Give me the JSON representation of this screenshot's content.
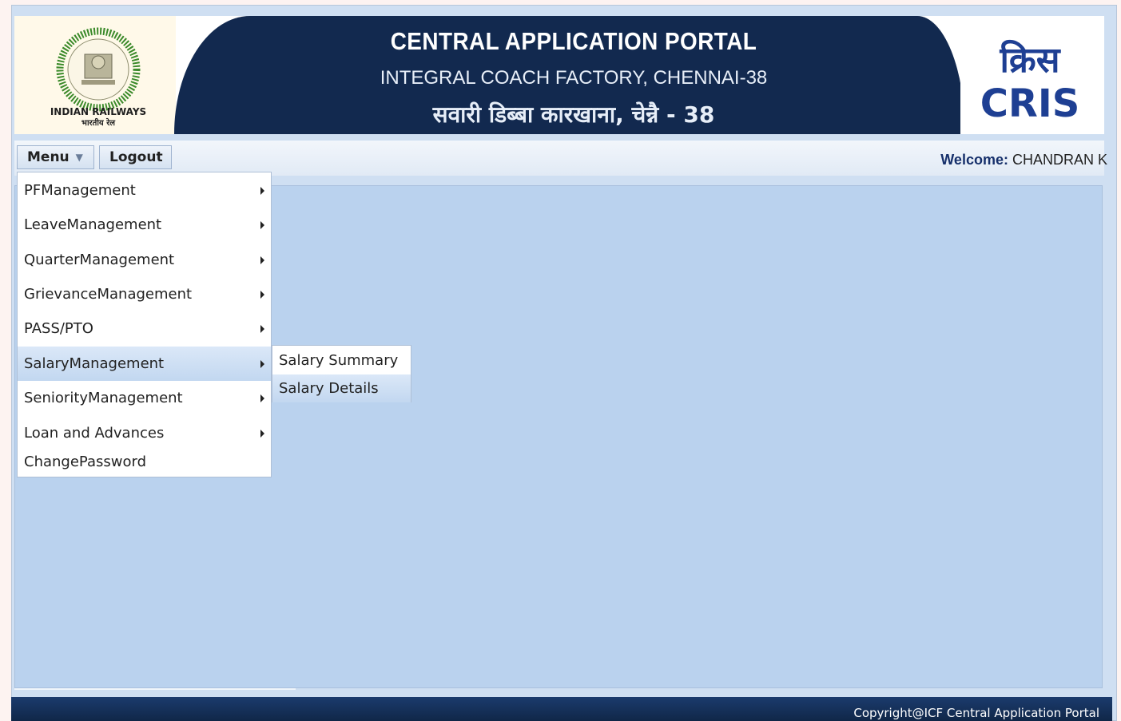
{
  "header": {
    "logo_left_text_1": "INDIAN RAILWAYS",
    "logo_left_text_2": "भारतीय रेल",
    "title": "CENTRAL APPLICATION PORTAL",
    "subtitle": "INTEGRAL COACH FACTORY, CHENNAI-38",
    "subtitle_hindi": "सवारी डिब्बा कारखाना, चेन्नै - 38",
    "logo_right_text": "CRIS",
    "logo_right_hindi": "क्रिस"
  },
  "menubar": {
    "menu_label": "Menu",
    "logout_label": "Logout",
    "welcome_label": "Welcome:",
    "welcome_user": "CHANDRAN K"
  },
  "menu": {
    "items": [
      {
        "label": "PFManagement",
        "has_submenu": true
      },
      {
        "label": "LeaveManagement",
        "has_submenu": true
      },
      {
        "label": "QuarterManagement",
        "has_submenu": true
      },
      {
        "label": "GrievanceManagement",
        "has_submenu": true
      },
      {
        "label": "PASS/PTO",
        "has_submenu": true
      },
      {
        "label": "SalaryManagement",
        "has_submenu": true
      },
      {
        "label": "SeniorityManagement",
        "has_submenu": true
      },
      {
        "label": "Loan and Advances",
        "has_submenu": true
      },
      {
        "label": "ChangePassword",
        "has_submenu": false
      }
    ],
    "active_index": 5
  },
  "submenu": {
    "items": [
      {
        "label": "Salary Summary"
      },
      {
        "label": "Salary Details"
      }
    ],
    "active_index": 1
  },
  "footer": {
    "copyright": "Copyright@ICF Central Application Portal"
  },
  "colors": {
    "banner_navy": "#12294f",
    "content_bg": "#bad2ee",
    "footer_bg": "#102748",
    "highlight": "#c2d7f0"
  }
}
